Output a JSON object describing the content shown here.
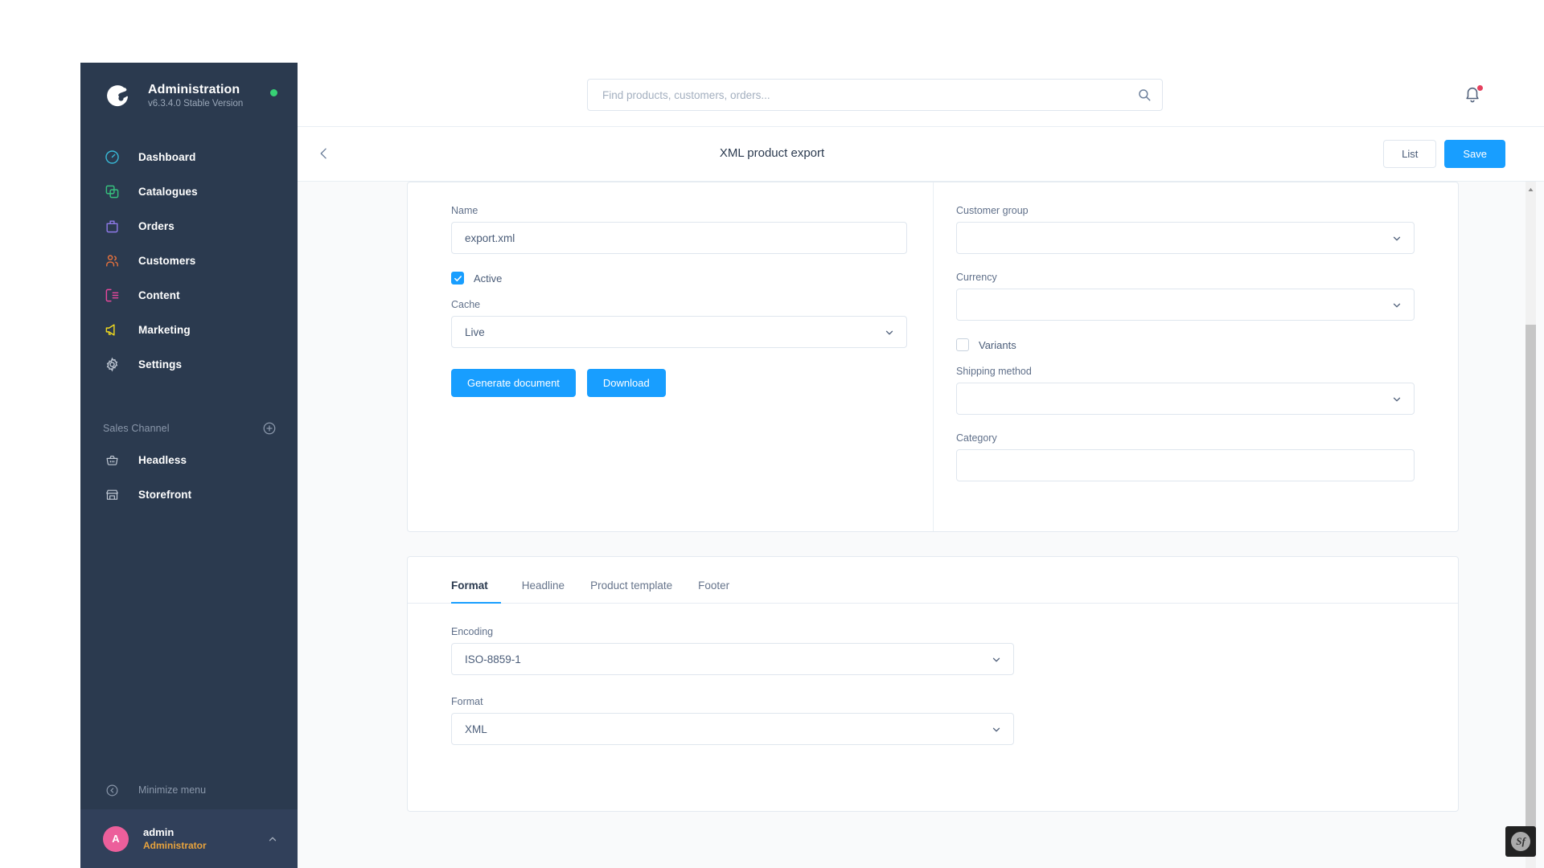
{
  "sidebar": {
    "brand": {
      "title": "Administration",
      "version": "v6.3.4.0 Stable Version",
      "logo_icon": "shopware-logo-icon",
      "status_icon": "online-status-dot"
    },
    "items": [
      {
        "label": "Dashboard",
        "icon": "dashboard-icon",
        "color": "#38b8d6"
      },
      {
        "label": "Catalogues",
        "icon": "catalogues-icon",
        "color": "#37c17e"
      },
      {
        "label": "Orders",
        "icon": "orders-icon",
        "color": "#8e79e8"
      },
      {
        "label": "Customers",
        "icon": "customers-icon",
        "color": "#e8723c"
      },
      {
        "label": "Content",
        "icon": "content-icon",
        "color": "#e8479d"
      },
      {
        "label": "Marketing",
        "icon": "marketing-icon",
        "color": "#f0d91f"
      },
      {
        "label": "Settings",
        "icon": "settings-gear-icon",
        "color": "#c0c8d4"
      }
    ],
    "section": {
      "title": "Sales Channel",
      "add_icon": "plus-circle-icon"
    },
    "channels": [
      {
        "label": "Headless",
        "icon": "headless-basket-icon"
      },
      {
        "label": "Storefront",
        "icon": "storefront-icon"
      }
    ],
    "minimize": {
      "label": "Minimize menu",
      "icon": "collapse-menu-icon"
    },
    "user": {
      "initial": "A",
      "name": "admin",
      "role": "Administrator",
      "caret_icon": "chevron-up-icon"
    }
  },
  "header": {
    "search": {
      "placeholder": "Find products, customers, orders...",
      "value": "",
      "icon": "search-icon"
    },
    "notifications": {
      "icon": "bell-icon",
      "has_badge": true
    }
  },
  "smartbar": {
    "back_icon": "chevron-left-icon",
    "title": "XML product export",
    "list_label": "List",
    "save_label": "Save"
  },
  "form": {
    "left": {
      "name": {
        "label": "Name",
        "value": "export.xml"
      },
      "active": {
        "label": "Active",
        "checked": true
      },
      "cache": {
        "label": "Cache",
        "value": "Live"
      },
      "generate_label": "Generate document",
      "download_label": "Download"
    },
    "right": {
      "customer_group": {
        "label": "Customer group",
        "value": ""
      },
      "currency": {
        "label": "Currency",
        "value": ""
      },
      "variants": {
        "label": "Variants",
        "checked": false
      },
      "shipping_method": {
        "label": "Shipping method",
        "value": ""
      },
      "category": {
        "label": "Category",
        "value": ""
      }
    }
  },
  "tabs": {
    "items": [
      {
        "label": "Format",
        "active": true
      },
      {
        "label": "Headline",
        "active": false
      },
      {
        "label": "Product template",
        "active": false
      },
      {
        "label": "Footer",
        "active": false
      }
    ],
    "panel": {
      "encoding": {
        "label": "Encoding",
        "value": "ISO-8859-1"
      },
      "format": {
        "label": "Format",
        "value": "XML"
      }
    }
  },
  "debug_toolbar": {
    "label": "Sf",
    "name": "symfony-profiler-icon"
  },
  "colors": {
    "accent": "#189eff",
    "sidebar_bg": "#2b3a4f",
    "avatar": "#ec5f9b",
    "role_text": "#e8a33d",
    "status_dot": "#37d275",
    "badge": "#e5405e"
  }
}
